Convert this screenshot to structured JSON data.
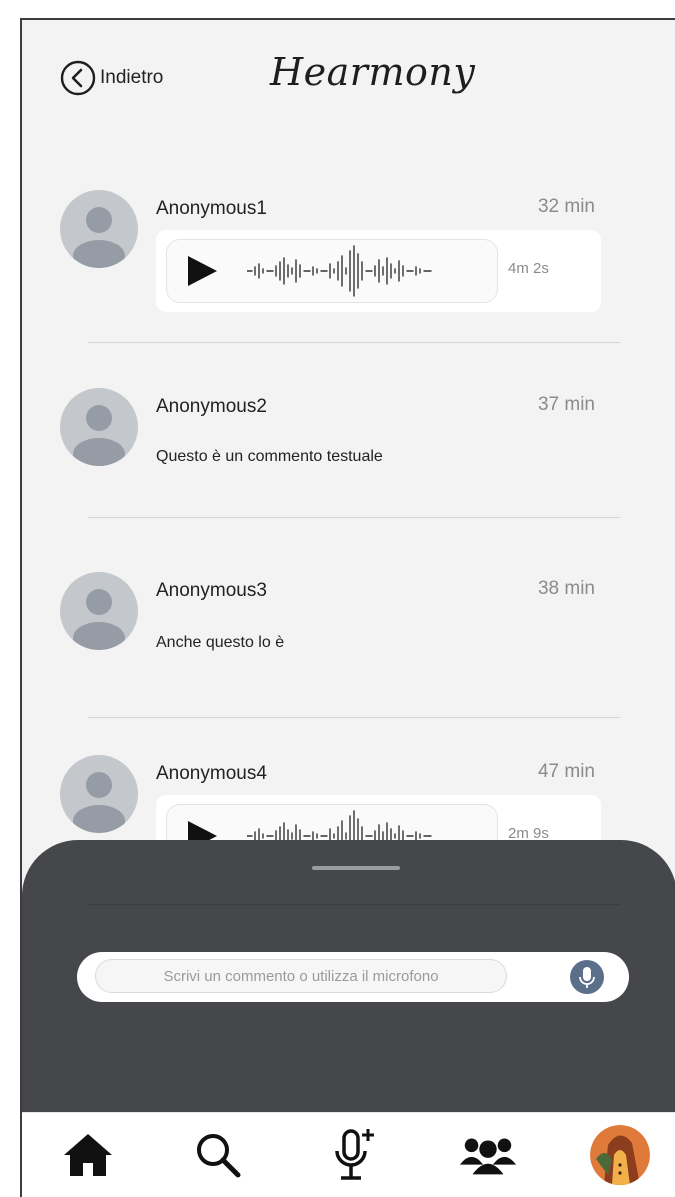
{
  "header": {
    "back_label": "Indietro",
    "brand": "Hearmony"
  },
  "comments": [
    {
      "author": "Anonymous1",
      "time": "32 min",
      "type": "audio",
      "duration": "4m 2s"
    },
    {
      "author": "Anonymous2",
      "time": "37 min",
      "type": "text",
      "text": "Questo è un commento testuale"
    },
    {
      "author": "Anonymous3",
      "time": "38 min",
      "type": "text",
      "text": "Anche questo lo è"
    },
    {
      "author": "Anonymous4",
      "time": "47 min",
      "type": "audio",
      "duration": "2m 9s"
    }
  ],
  "composer": {
    "placeholder": "Scrivi un commento o utilizza il microfono"
  },
  "nav": {
    "items": [
      "home-icon",
      "search-icon",
      "mic-plus-icon",
      "community-icon",
      "profile-avatar"
    ]
  },
  "colors": {
    "background": "#f3f3f3",
    "sheet": "#45474b",
    "mic_button": "#5b6f8a",
    "avatar_placeholder": "#c4c7cc"
  }
}
